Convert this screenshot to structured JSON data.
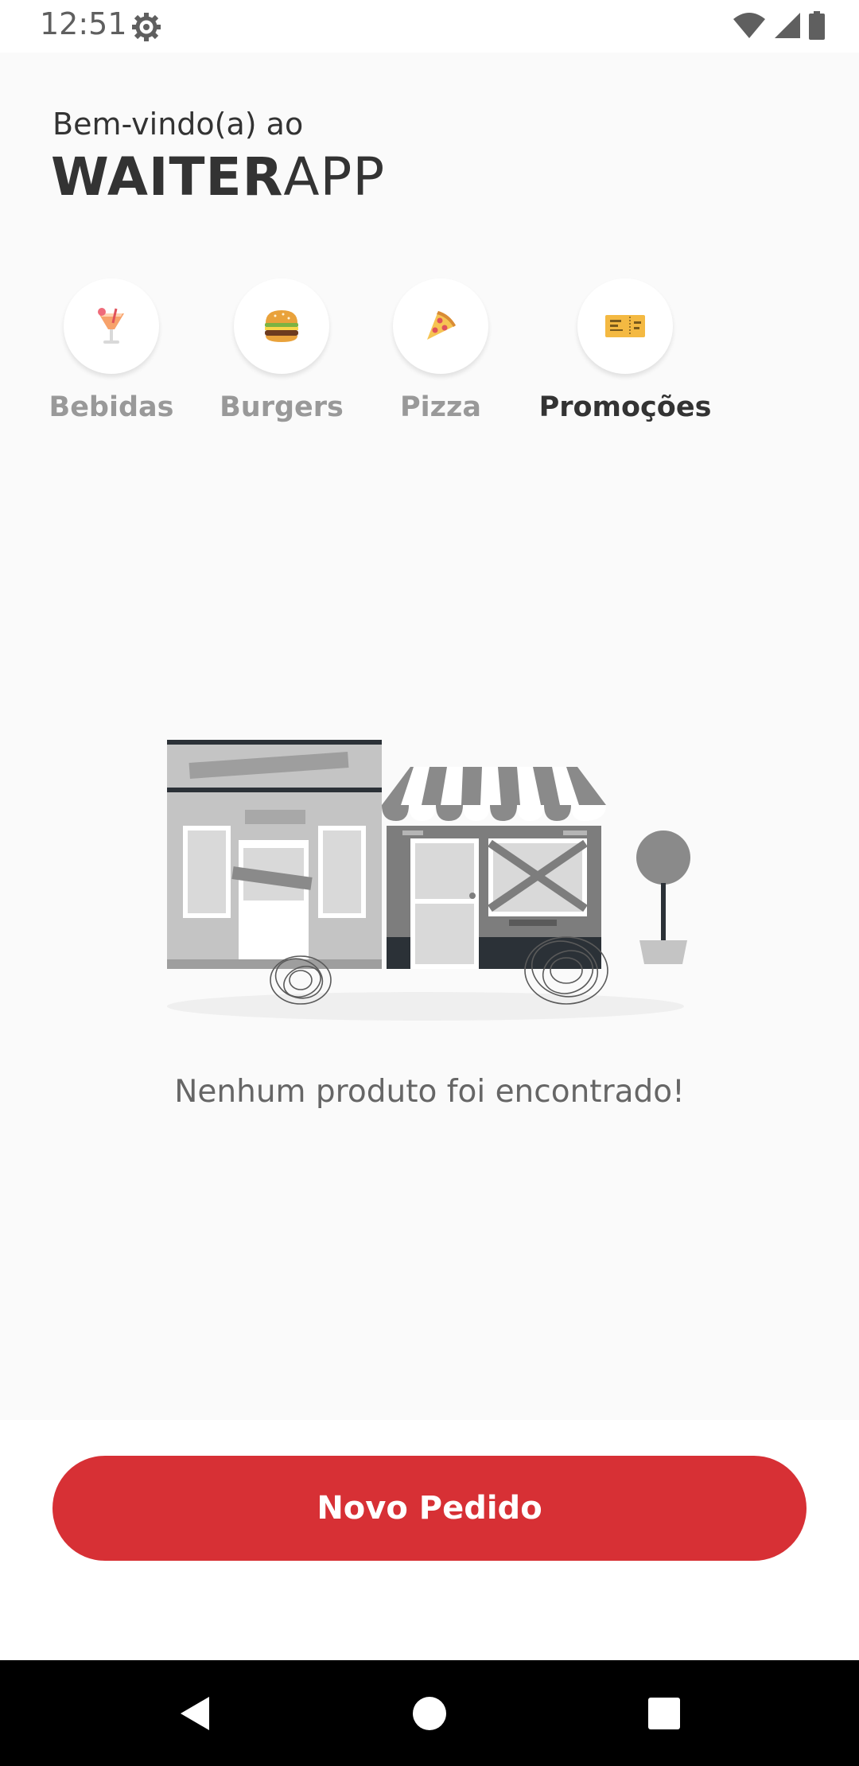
{
  "status_bar": {
    "time": "12:51",
    "icons": [
      "gear-icon",
      "wifi-icon",
      "cellular-signal-icon",
      "battery-icon"
    ]
  },
  "header": {
    "welcome": "Bem-vindo(a) ao",
    "brand_bold": "WAITER",
    "brand_light": "APP"
  },
  "categories": [
    {
      "label": "Bebidas",
      "icon": "cocktail-emoji-icon",
      "emoji": "🍹",
      "active": false
    },
    {
      "label": "Burgers",
      "icon": "burger-emoji-icon",
      "emoji": "🍔",
      "active": false
    },
    {
      "label": "Pizza",
      "icon": "pizza-emoji-icon",
      "emoji": "🍕",
      "active": false
    },
    {
      "label": "Promoções",
      "icon": "ticket-emoji-icon",
      "emoji": "🎫",
      "active": true
    }
  ],
  "empty_state": {
    "message": "Nenhum produto foi encontrado!",
    "illustration": "closed-store-illustration"
  },
  "footer": {
    "new_order_label": "Novo Pedido"
  },
  "nav": {
    "icons": [
      "back-icon",
      "home-icon",
      "recents-icon"
    ]
  },
  "colors": {
    "accent": "#d73035",
    "background": "#fafafa",
    "text_primary": "#333333",
    "text_muted": "#999999"
  }
}
